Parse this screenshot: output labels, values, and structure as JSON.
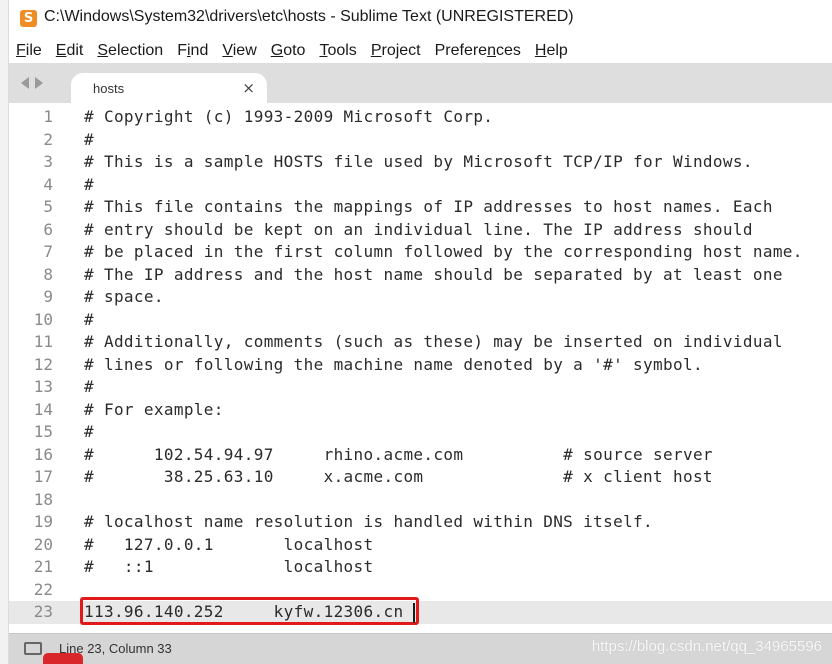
{
  "window": {
    "title": "C:\\Windows\\System32\\drivers\\etc\\hosts - Sublime Text (UNREGISTERED)"
  },
  "menu": [
    {
      "pre": "",
      "ul": "F",
      "post": "ile"
    },
    {
      "pre": "",
      "ul": "E",
      "post": "dit"
    },
    {
      "pre": "",
      "ul": "S",
      "post": "election"
    },
    {
      "pre": "F",
      "ul": "i",
      "post": "nd"
    },
    {
      "pre": "",
      "ul": "V",
      "post": "iew"
    },
    {
      "pre": "",
      "ul": "G",
      "post": "oto"
    },
    {
      "pre": "",
      "ul": "T",
      "post": "ools"
    },
    {
      "pre": "",
      "ul": "P",
      "post": "roject"
    },
    {
      "pre": "Prefere",
      "ul": "n",
      "post": "ces"
    },
    {
      "pre": "",
      "ul": "H",
      "post": "elp"
    }
  ],
  "tab": {
    "label": "hosts",
    "close_glyph": "×"
  },
  "editor": {
    "current_line": 23,
    "lines": [
      "# Copyright (c) 1993-2009 Microsoft Corp.",
      "#",
      "# This is a sample HOSTS file used by Microsoft TCP/IP for Windows.",
      "#",
      "# This file contains the mappings of IP addresses to host names. Each",
      "# entry should be kept on an individual line. The IP address should",
      "# be placed in the first column followed by the corresponding host name.",
      "# The IP address and the host name should be separated by at least one",
      "# space.",
      "#",
      "# Additionally, comments (such as these) may be inserted on individual",
      "# lines or following the machine name denoted by a '#' symbol.",
      "#",
      "# For example:",
      "#",
      "#      102.54.94.97     rhino.acme.com          # source server",
      "#       38.25.63.10     x.acme.com              # x client host",
      "",
      "# localhost name resolution is handled within DNS itself.",
      "#   127.0.0.1       localhost",
      "#   ::1             localhost",
      "",
      "113.96.140.252     kyfw.12306.cn"
    ]
  },
  "status": {
    "position": "Line 23, Column 33",
    "watermark": "https://blog.csdn.net/qq_34965596"
  },
  "colors": {
    "highlight_box": "#e0191b",
    "app_icon": "#f08c25"
  },
  "icons": {
    "app": "sublime-text-logo",
    "status": "panel-toggle-icon"
  }
}
